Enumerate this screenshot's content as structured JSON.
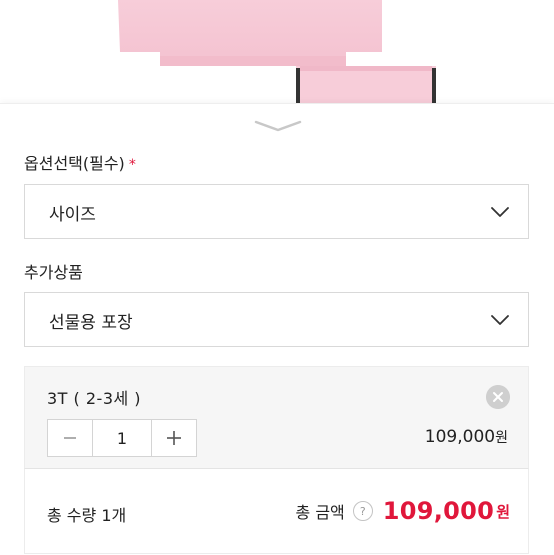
{
  "option_section": {
    "label": "옵션선택(필수)",
    "required_mark": "*"
  },
  "size_select": {
    "value": "사이즈"
  },
  "addon_section": {
    "label": "추가상품"
  },
  "addon_select": {
    "value": "선물용 포장"
  },
  "selected_option": {
    "name": "3T ( 2-3세 )",
    "quantity": "1",
    "price": "109,000",
    "currency": "원"
  },
  "summary": {
    "qty_prefix": "총 수량 ",
    "qty_value": "1",
    "qty_unit": "개",
    "amount_label": "총 금액",
    "help_icon_text": "?",
    "amount": "109,000",
    "currency": "원"
  },
  "colors": {
    "accent": "#e0173b",
    "product_pink": "#f7cdd9",
    "border": "#d9d9d9"
  }
}
